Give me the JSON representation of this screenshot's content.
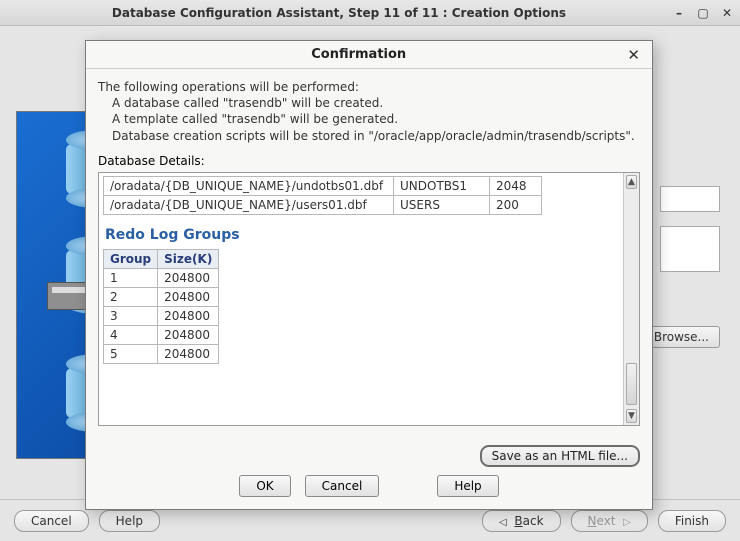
{
  "window": {
    "title": "Database Configuration Assistant, Step 11 of 11 : Creation Options"
  },
  "wizard_footer": {
    "cancel": "Cancel",
    "help": "Help",
    "back": "Back",
    "next": "Next",
    "finish": "Finish"
  },
  "side_browse": "Browse...",
  "modal": {
    "title": "Confirmation",
    "intro": "The following operations will be performed:",
    "line1": "A database called \"trasendb\" will be created.",
    "line2": "A template called \"trasendb\" will be generated.",
    "line3": "Database creation scripts will be stored in \"/oracle/app/oracle/admin/trasendb/scripts\".",
    "details_label": "Database Details:",
    "file_rows": [
      {
        "path": "/oradata/{DB_UNIQUE_NAME}/undotbs01.dbf",
        "ts": "UNDOTBS1",
        "size": "2048"
      },
      {
        "path": "/oradata/{DB_UNIQUE_NAME}/users01.dbf",
        "ts": "USERS",
        "size": "200"
      }
    ],
    "redo_title": "Redo Log Groups",
    "redo_headers": {
      "group": "Group",
      "size": "Size(K)"
    },
    "redo_rows": [
      {
        "group": "1",
        "size": "204800"
      },
      {
        "group": "2",
        "size": "204800"
      },
      {
        "group": "3",
        "size": "204800"
      },
      {
        "group": "4",
        "size": "204800"
      },
      {
        "group": "5",
        "size": "204800"
      }
    ],
    "save_btn": "Save as an HTML file...",
    "ok": "OK",
    "cancel": "Cancel",
    "help": "Help"
  }
}
